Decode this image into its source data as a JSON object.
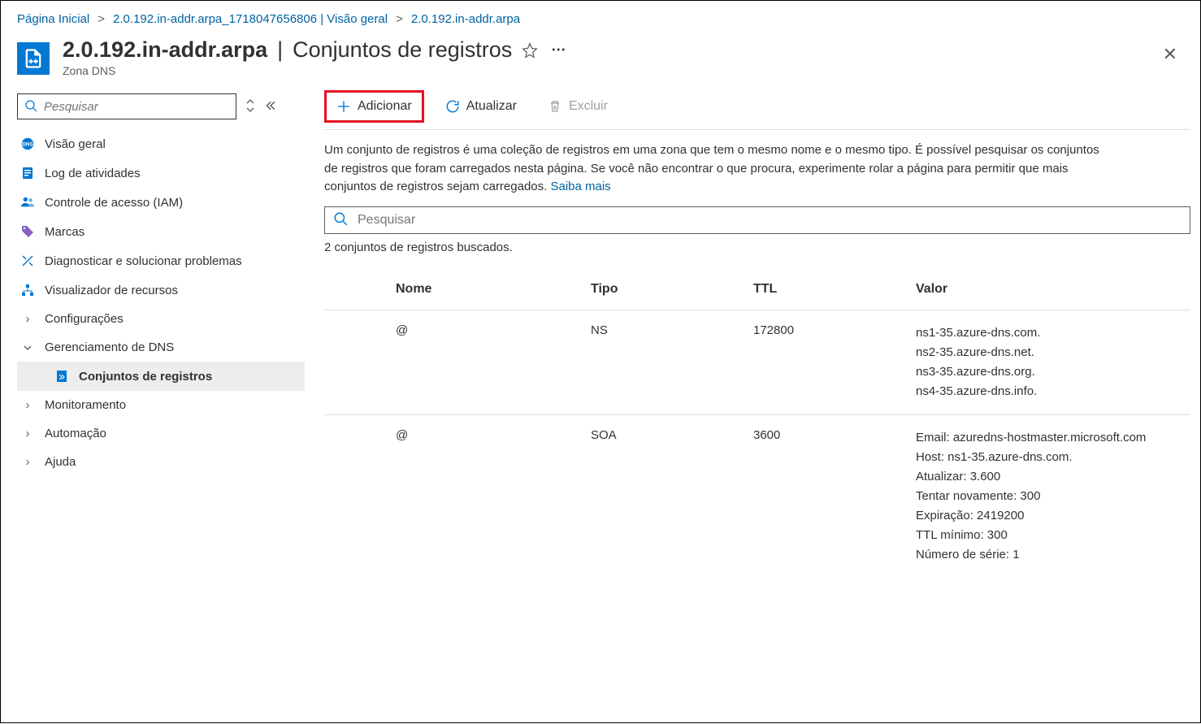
{
  "breadcrumb": {
    "home": "Página Inicial",
    "overview": "2.0.192.in-addr.arpa_1718047656806 | Visão geral",
    "zone": "2.0.192.in-addr.arpa"
  },
  "header": {
    "title": "2.0.192.in-addr.arpa",
    "subtitle": "Conjuntos de registros",
    "resource_type": "Zona DNS"
  },
  "sidebar": {
    "search_placeholder": "Pesquisar",
    "items": [
      {
        "label": "Visão geral",
        "icon": "globe-dns-icon",
        "color": "#0078d4"
      },
      {
        "label": "Log de atividades",
        "icon": "log-icon",
        "color": "#0078d4"
      },
      {
        "label": "Controle de acesso (IAM)",
        "icon": "people-icon",
        "color": "#0078d4"
      },
      {
        "label": "Marcas",
        "icon": "tags-icon",
        "color": "#8661c5"
      },
      {
        "label": "Diagnosticar e solucionar problemas",
        "icon": "diagnose-icon",
        "color": "#0078d4"
      },
      {
        "label": "Visualizador de recursos",
        "icon": "resource-viewer-icon",
        "color": "#0078d4"
      }
    ],
    "groups": [
      {
        "label": "Configurações",
        "expanded": false
      },
      {
        "label": "Gerenciamento de DNS",
        "expanded": true,
        "children": [
          {
            "label": "Conjuntos de registros",
            "icon": "recordset-icon",
            "selected": true
          }
        ]
      },
      {
        "label": "Monitoramento",
        "expanded": false
      },
      {
        "label": "Automação",
        "expanded": false
      },
      {
        "label": "Ajuda",
        "expanded": false
      }
    ]
  },
  "toolbar": {
    "add": "Adicionar",
    "refresh": "Atualizar",
    "delete": "Excluir"
  },
  "description": {
    "text": "Um conjunto de registros é uma coleção de registros em uma zona que tem o mesmo nome e o mesmo tipo. É possível pesquisar os conjuntos de registros que foram carregados nesta página. Se você não encontrar o que procura, experimente rolar a página para permitir que mais conjuntos de registros sejam carregados. ",
    "learn_more": "Saiba mais"
  },
  "filter": {
    "placeholder": "Pesquisar"
  },
  "count_text": "2 conjuntos de registros buscados.",
  "table": {
    "headers": {
      "name": "Nome",
      "type": "Tipo",
      "ttl": "TTL",
      "value": "Valor"
    },
    "rows": [
      {
        "name": "@",
        "type": "NS",
        "ttl": "172800",
        "value": "ns1-35.azure-dns.com.\nns2-35.azure-dns.net.\nns3-35.azure-dns.org.\nns4-35.azure-dns.info."
      },
      {
        "name": "@",
        "type": "SOA",
        "ttl": "3600",
        "value": "Email: azuredns-hostmaster.microsoft.com\nHost: ns1-35.azure-dns.com.\nAtualizar: 3.600\nTentar novamente: 300\nExpiração: 2419200\nTTL mínimo: 300\nNúmero de série: 1"
      }
    ]
  }
}
